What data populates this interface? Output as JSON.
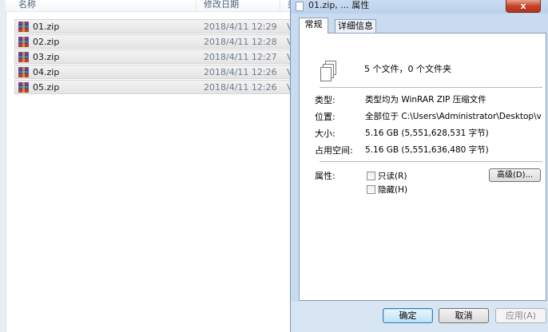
{
  "explorer": {
    "columns": {
      "name": "名称",
      "date": "修改日期",
      "type_partial": "类"
    },
    "files": [
      {
        "name": "01.zip",
        "date": "2018/4/11 12:29",
        "type_partial": "V"
      },
      {
        "name": "02.zip",
        "date": "2018/4/11 12:28",
        "type_partial": "V"
      },
      {
        "name": "03.zip",
        "date": "2018/4/11 12:27",
        "type_partial": "V"
      },
      {
        "name": "04.zip",
        "date": "2018/4/11 12:26",
        "type_partial": "V"
      },
      {
        "name": "05.zip",
        "date": "2018/4/11 12:26",
        "type_partial": "V"
      }
    ],
    "file_icon": "winrar-archive-icon"
  },
  "dialog": {
    "title": "01.zip, ... 属性",
    "close_label": "x",
    "tabs": [
      {
        "label": "常规"
      },
      {
        "label": "详细信息"
      }
    ],
    "summary": "5 个文件，0 个文件夹",
    "type_label": "类型:",
    "type_value": "类型均为 WinRAR ZIP 压缩文件",
    "location_label": "位置:",
    "location_value": "全部位于 C:\\Users\\Administrator\\Desktop\\v",
    "size_label": "大小:",
    "size_value": "5.16 GB (5,551,628,531 字节)",
    "disk_size_label": "占用空间:",
    "disk_size_value": "5.16 GB (5,551,636,480 字节)",
    "attributes_label": "属性:",
    "readonly_label": "只读(R)",
    "hidden_label": "隐藏(H)",
    "advanced_label": "高级(D)...",
    "ok_label": "确定",
    "cancel_label": "取消",
    "apply_label": "应用(A)"
  }
}
